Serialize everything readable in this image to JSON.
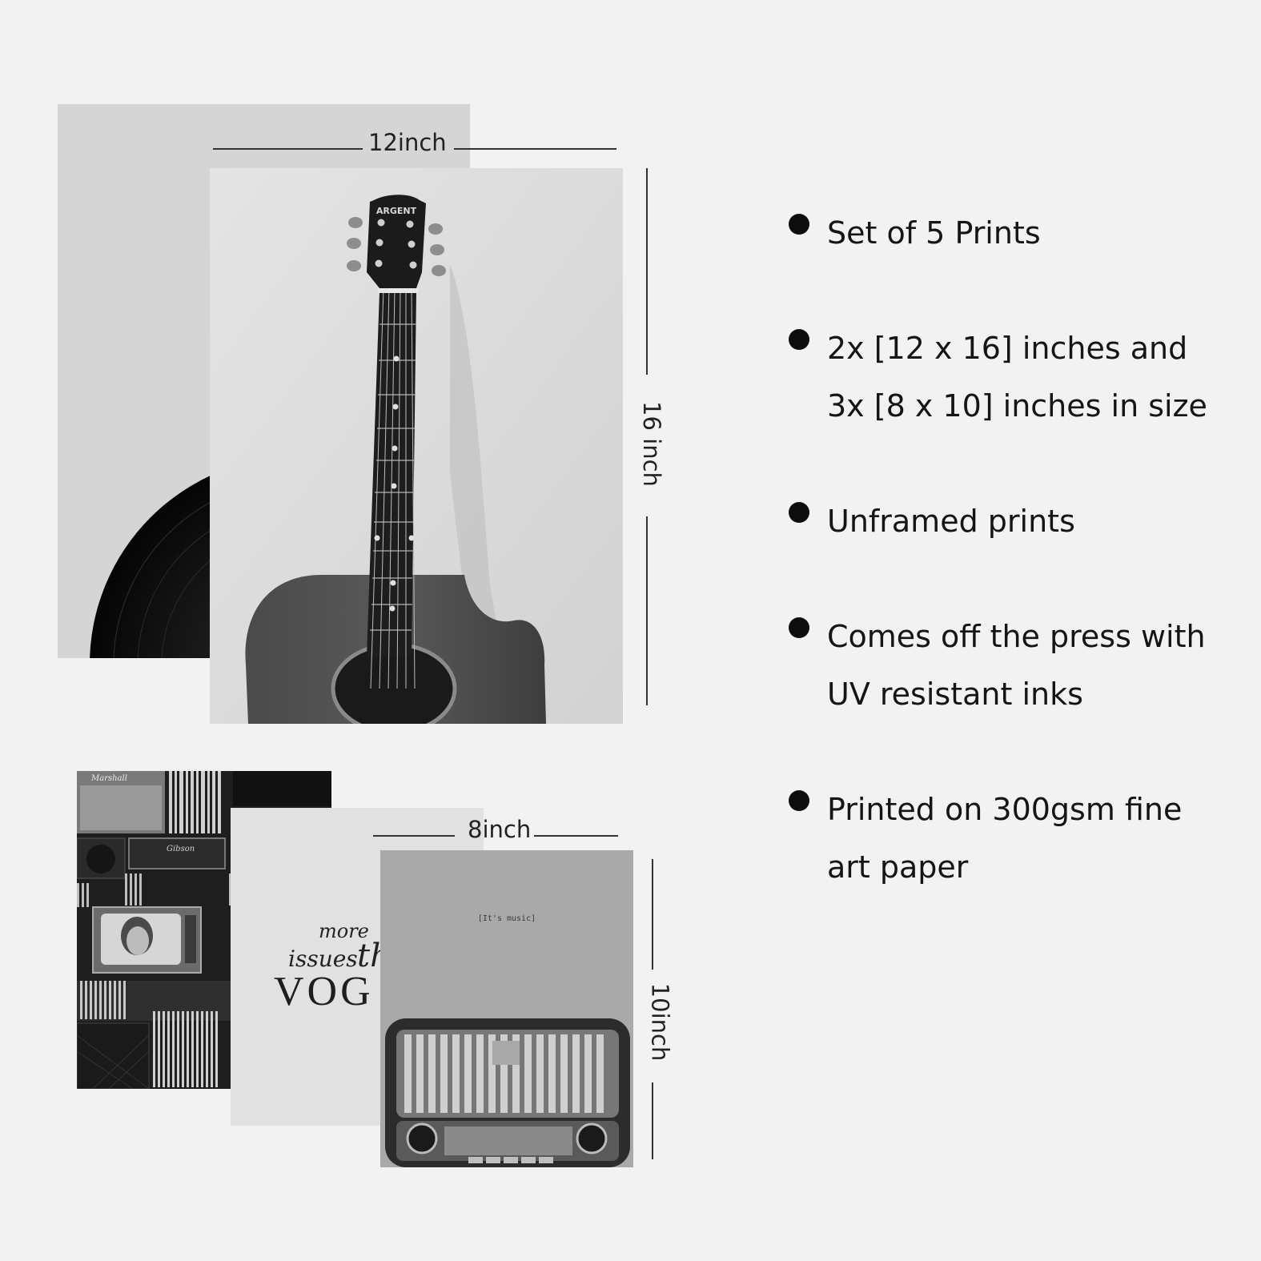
{
  "dimensions": {
    "large_width": "12inch",
    "large_height": "16 inch",
    "small_width": "8inch",
    "small_height": "10inch"
  },
  "prints": {
    "guitar": {
      "headstock_brand": "ARGENT"
    },
    "shelf": {
      "amp_brand": "Marshall",
      "amp_brand_2": "Gibson"
    },
    "vogue": {
      "script_line_1": "more",
      "script_line_2": "issues",
      "script_tail": "th",
      "title": "VOG"
    },
    "radio": {
      "caption": "[It's music]"
    }
  },
  "features": [
    {
      "lines": [
        "Set of 5 Prints"
      ]
    },
    {
      "lines": [
        "2x [12 x 16] inches and",
        "3x [8 x 10] inches in size"
      ]
    },
    {
      "lines": [
        "Unframed prints"
      ]
    },
    {
      "lines": [
        "Comes off the press with",
        "UV resistant inks"
      ]
    },
    {
      "lines": [
        "Printed on 300gsm fine",
        "art paper"
      ]
    }
  ]
}
